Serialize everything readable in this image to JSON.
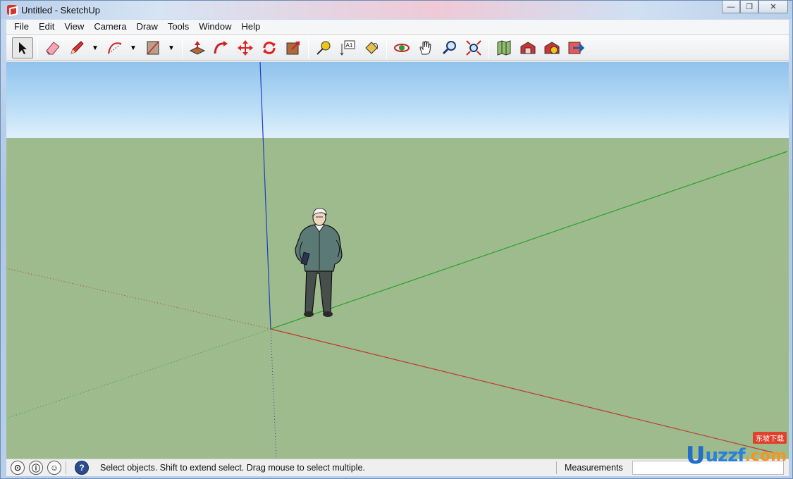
{
  "window": {
    "title": "Untitled - SketchUp",
    "minimize": "—",
    "maximize": "❐",
    "close": "✕"
  },
  "menu": [
    "File",
    "Edit",
    "View",
    "Camera",
    "Draw",
    "Tools",
    "Window",
    "Help"
  ],
  "toolbar": {
    "tools": [
      {
        "name": "select-tool",
        "glyph": "➤"
      },
      {
        "name": "eraser-tool",
        "glyph": "▰"
      },
      {
        "name": "pencil-tool",
        "glyph": "✎"
      },
      {
        "name": "arc-tool",
        "glyph": "◠"
      },
      {
        "name": "rectangle-tool",
        "glyph": "▨"
      },
      {
        "name": "push-pull-tool",
        "glyph": "⇪"
      },
      {
        "name": "follow-me-tool",
        "glyph": "↷"
      },
      {
        "name": "move-tool",
        "glyph": "✥"
      },
      {
        "name": "rotate-tool",
        "glyph": "↻"
      },
      {
        "name": "scale-tool",
        "glyph": "⤢"
      },
      {
        "name": "tape-measure-tool",
        "glyph": "⚲"
      },
      {
        "name": "text-tool",
        "glyph": "A1"
      },
      {
        "name": "paint-bucket-tool",
        "glyph": "⛽"
      },
      {
        "name": "orbit-tool",
        "glyph": "⟳"
      },
      {
        "name": "pan-tool",
        "glyph": "✋"
      },
      {
        "name": "zoom-tool",
        "glyph": "⚲"
      },
      {
        "name": "zoom-extents-tool",
        "glyph": "⤧"
      },
      {
        "name": "add-location-tool",
        "glyph": "▦"
      },
      {
        "name": "warehouse-tool",
        "glyph": "◈"
      },
      {
        "name": "share-model-tool",
        "glyph": "◉"
      },
      {
        "name": "extension-warehouse-tool",
        "glyph": "⬈"
      }
    ]
  },
  "status": {
    "message": "Select objects. Shift to extend select. Drag mouse to select multiple.",
    "measurements_label": "Measurements",
    "measurements_value": ""
  },
  "watermark": {
    "u": "U",
    "rest": "uzzf",
    "com": ".com",
    "tag": "东坡下载"
  },
  "colors": {
    "sky_top": "#8fc2ec",
    "ground": "#9dbb8c",
    "axis_red": "#c0392b",
    "axis_green": "#2ca02c",
    "axis_blue": "#1f3fbf"
  }
}
